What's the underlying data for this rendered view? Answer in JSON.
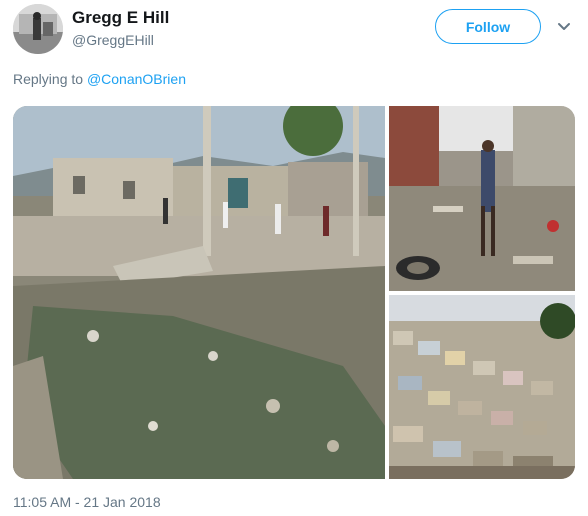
{
  "tweet": {
    "author_name": "Gregg E Hill",
    "author_handle": "@GreggEHill",
    "follow_label": "Follow",
    "reply_prefix": "Replying to",
    "reply_to": "@ConanOBrien",
    "timestamp": "11:05 AM - 21 Jan 2018"
  },
  "colors": {
    "accent": "#1da1f2",
    "secondary_text": "#657786",
    "primary_text": "#14171a"
  },
  "icons": {
    "menu": "chevron-down-icon"
  }
}
